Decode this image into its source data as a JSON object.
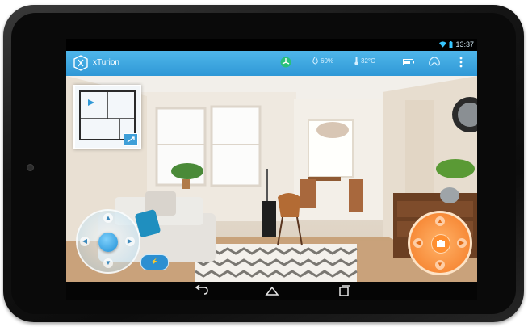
{
  "status": {
    "time": "13:37",
    "wifi_icon": "wifi-icon",
    "battery_icon": "battery-icon"
  },
  "app": {
    "title": "xTurion",
    "accent": "#3aa7e0"
  },
  "toolbar": {
    "humidity": "60%",
    "temperature": "32°C",
    "fan_icon": "fan-icon",
    "battery_icon": "battery-icon",
    "control_icon": "gamepad-icon",
    "menu_icon": "overflow-menu-icon"
  },
  "controls": {
    "left_joystick": "movement-joystick",
    "right_joystick": "camera-joystick",
    "charge_label": "⚡"
  },
  "navigation": {
    "back": "back-icon",
    "home": "home-icon",
    "recents": "recents-icon"
  }
}
